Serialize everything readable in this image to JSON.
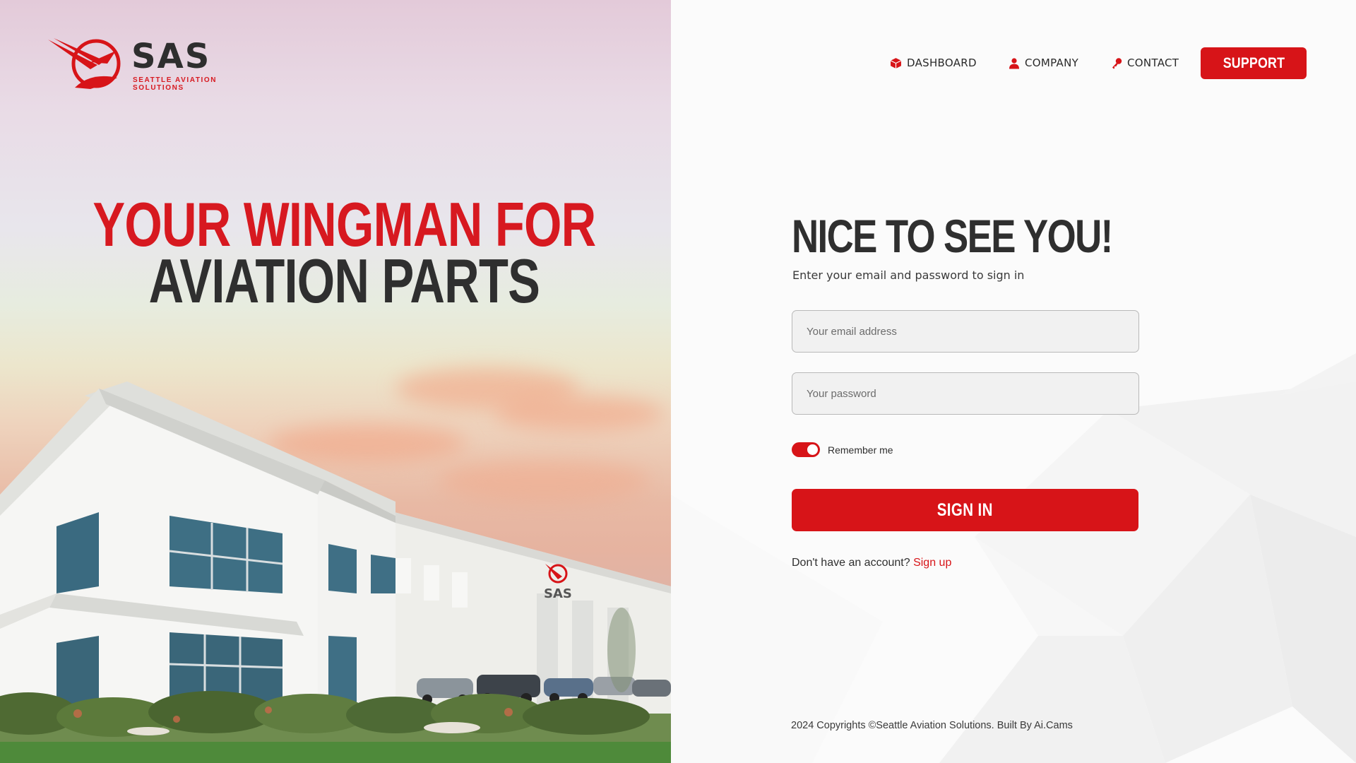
{
  "brand": {
    "name": "SAS",
    "tagline": "SEATTLE AVIATION SOLUTIONS",
    "sign_text": "SAS",
    "accent_color": "#d71418",
    "dark_color": "#2f2f2f"
  },
  "hero": {
    "line1": "YOUR WINGMAN FOR",
    "line2": "AVIATION PARTS"
  },
  "nav": {
    "items": [
      {
        "label": "DASHBOARD",
        "icon": "cube-icon"
      },
      {
        "label": "COMPANY",
        "icon": "user-icon"
      },
      {
        "label": "CONTACT",
        "icon": "key-icon"
      }
    ],
    "support_label": "SUPPORT"
  },
  "form": {
    "title": "NICE TO SEE YOU!",
    "subtitle": "Enter your email and password to sign in",
    "email_placeholder": "Your email address",
    "password_placeholder": "Your password",
    "remember_label": "Remember me",
    "remember_checked": true,
    "signin_label": "SIGN IN",
    "signup_prompt": "Don't have an account?",
    "signup_link": "Sign up"
  },
  "footer": {
    "text": "2024 Copyrights ©Seattle Aviation Solutions. Built By Ai.Cams"
  }
}
